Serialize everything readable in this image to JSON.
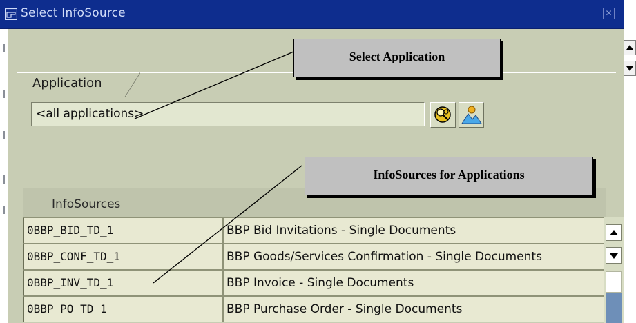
{
  "window": {
    "title": "Select InfoSource",
    "close_glyph": "✕"
  },
  "application_group": {
    "label": "Application",
    "field_value": "<all applications>"
  },
  "toolbar": {
    "search_icon": "search-coins-icon",
    "picture_icon": "picture-icon"
  },
  "table": {
    "header": "InfoSources",
    "rows": [
      {
        "id": "0BBP_BID_TD_1",
        "description": "BBP Bid Invitations - Single Documents"
      },
      {
        "id": "0BBP_CONF_TD_1",
        "description": "BBP Goods/Services Confirmation - Single Documents"
      },
      {
        "id": "0BBP_INV_TD_1",
        "description": "BBP Invoice - Single Documents"
      },
      {
        "id": "0BBP_PO_TD_1",
        "description": "BBP Purchase Order - Single Documents"
      }
    ]
  },
  "callouts": {
    "select_application": "Select Application",
    "infosources_for_applications": "InfoSources for Applications"
  },
  "colors": {
    "titlebar": "#0e2d8e",
    "panel": "#c8cdb4",
    "table_cell": "#e8e9d2",
    "scroll_thumb": "#6e8fb8",
    "callout": "#c0c0c0"
  }
}
